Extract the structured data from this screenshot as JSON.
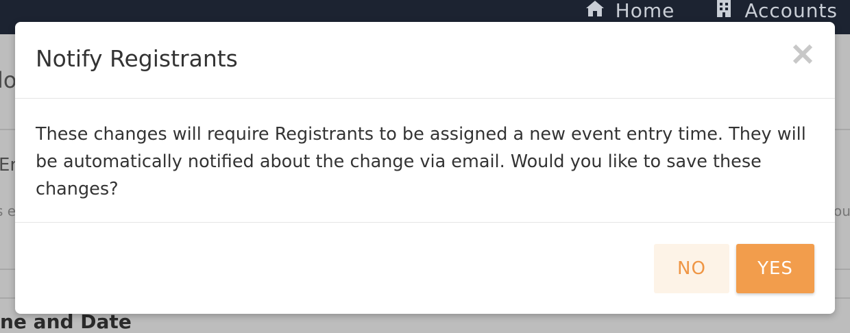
{
  "topnav": {
    "items": [
      {
        "label": "Home",
        "icon": "home-icon"
      },
      {
        "label": "Accounts",
        "icon": "building-icon"
      }
    ]
  },
  "background": {
    "fragment_1": "lo",
    "fragment_2": "En",
    "fragment_3": "s e",
    "fragment_4": "ou",
    "heading": "ne and Date"
  },
  "modal": {
    "title": "Notify Registrants",
    "body": "These changes will require Registrants to be assigned a new event entry time. They will be automatically notified about the change via email. Would you like to save these changes?",
    "no_label": "NO",
    "yes_label": "YES",
    "close_icon": "close-icon"
  },
  "colors": {
    "accent": "#f29d4c",
    "accent_light": "#fdf3e7",
    "topbar": "#1c2331"
  }
}
